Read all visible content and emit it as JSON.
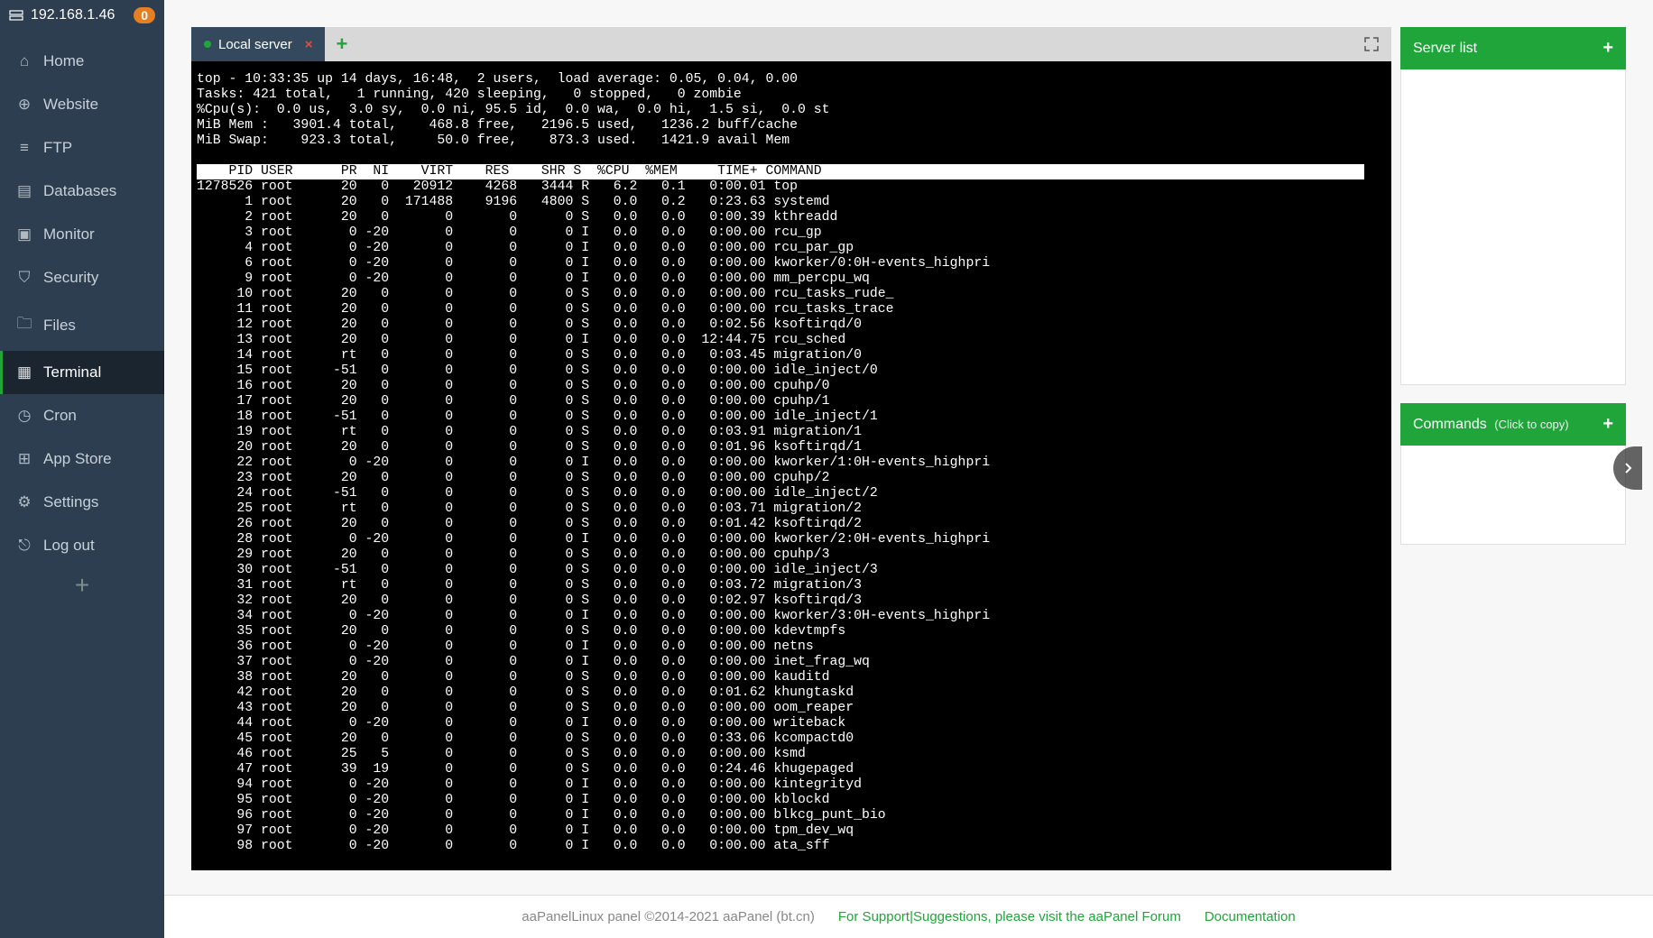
{
  "sidebar": {
    "ip": "192.168.1.46",
    "badge": "0",
    "items": [
      {
        "id": "home",
        "label": "Home"
      },
      {
        "id": "website",
        "label": "Website"
      },
      {
        "id": "ftp",
        "label": "FTP"
      },
      {
        "id": "databases",
        "label": "Databases"
      },
      {
        "id": "monitor",
        "label": "Monitor"
      },
      {
        "id": "security",
        "label": "Security"
      },
      {
        "id": "files",
        "label": "Files"
      },
      {
        "id": "terminal",
        "label": "Terminal"
      },
      {
        "id": "cron",
        "label": "Cron"
      },
      {
        "id": "appstore",
        "label": "App Store"
      },
      {
        "id": "settings",
        "label": "Settings"
      },
      {
        "id": "logout",
        "label": "Log out"
      }
    ],
    "active": "terminal"
  },
  "tabs": {
    "active_label": "Local server"
  },
  "right": {
    "server_list": "Server list",
    "commands_label": "Commands",
    "commands_hint": "(Click to copy)"
  },
  "footer": {
    "copyright": "aaPanelLinux panel ©2014-2021 aaPanel (bt.cn)",
    "forum": "For Support|Suggestions, please visit the aaPanel Forum",
    "docs": "Documentation"
  },
  "top": {
    "summary": [
      "top - 10:33:35 up 14 days, 16:48,  2 users,  load average: 0.05, 0.04, 0.00",
      "Tasks: 421 total,   1 running, 420 sleeping,   0 stopped,   0 zombie",
      "%Cpu(s):  0.0 us,  3.0 sy,  0.0 ni, 95.5 id,  0.0 wa,  0.0 hi,  1.5 si,  0.0 st",
      "MiB Mem :   3901.4 total,    468.8 free,   2196.5 used,   1236.2 buff/cache",
      "MiB Swap:    923.3 total,     50.0 free,    873.3 used.   1421.9 avail Mem"
    ],
    "header": "    PID USER      PR  NI    VIRT    RES    SHR S  %CPU  %MEM     TIME+ COMMAND",
    "rows": [
      {
        "pid": 1278526,
        "user": "root",
        "pr": "20",
        "ni": "0",
        "virt": "20912",
        "res": "4268",
        "shr": "3444",
        "s": "R",
        "cpu": "6.2",
        "mem": "0.1",
        "time": "0:00.01",
        "cmd": "top"
      },
      {
        "pid": 1,
        "user": "root",
        "pr": "20",
        "ni": "0",
        "virt": "171488",
        "res": "9196",
        "shr": "4800",
        "s": "S",
        "cpu": "0.0",
        "mem": "0.2",
        "time": "0:23.63",
        "cmd": "systemd"
      },
      {
        "pid": 2,
        "user": "root",
        "pr": "20",
        "ni": "0",
        "virt": "0",
        "res": "0",
        "shr": "0",
        "s": "S",
        "cpu": "0.0",
        "mem": "0.0",
        "time": "0:00.39",
        "cmd": "kthreadd"
      },
      {
        "pid": 3,
        "user": "root",
        "pr": "0",
        "ni": "-20",
        "virt": "0",
        "res": "0",
        "shr": "0",
        "s": "I",
        "cpu": "0.0",
        "mem": "0.0",
        "time": "0:00.00",
        "cmd": "rcu_gp"
      },
      {
        "pid": 4,
        "user": "root",
        "pr": "0",
        "ni": "-20",
        "virt": "0",
        "res": "0",
        "shr": "0",
        "s": "I",
        "cpu": "0.0",
        "mem": "0.0",
        "time": "0:00.00",
        "cmd": "rcu_par_gp"
      },
      {
        "pid": 6,
        "user": "root",
        "pr": "0",
        "ni": "-20",
        "virt": "0",
        "res": "0",
        "shr": "0",
        "s": "I",
        "cpu": "0.0",
        "mem": "0.0",
        "time": "0:00.00",
        "cmd": "kworker/0:0H-events_highpri"
      },
      {
        "pid": 9,
        "user": "root",
        "pr": "0",
        "ni": "-20",
        "virt": "0",
        "res": "0",
        "shr": "0",
        "s": "I",
        "cpu": "0.0",
        "mem": "0.0",
        "time": "0:00.00",
        "cmd": "mm_percpu_wq"
      },
      {
        "pid": 10,
        "user": "root",
        "pr": "20",
        "ni": "0",
        "virt": "0",
        "res": "0",
        "shr": "0",
        "s": "S",
        "cpu": "0.0",
        "mem": "0.0",
        "time": "0:00.00",
        "cmd": "rcu_tasks_rude_"
      },
      {
        "pid": 11,
        "user": "root",
        "pr": "20",
        "ni": "0",
        "virt": "0",
        "res": "0",
        "shr": "0",
        "s": "S",
        "cpu": "0.0",
        "mem": "0.0",
        "time": "0:00.00",
        "cmd": "rcu_tasks_trace"
      },
      {
        "pid": 12,
        "user": "root",
        "pr": "20",
        "ni": "0",
        "virt": "0",
        "res": "0",
        "shr": "0",
        "s": "S",
        "cpu": "0.0",
        "mem": "0.0",
        "time": "0:02.56",
        "cmd": "ksoftirqd/0"
      },
      {
        "pid": 13,
        "user": "root",
        "pr": "20",
        "ni": "0",
        "virt": "0",
        "res": "0",
        "shr": "0",
        "s": "I",
        "cpu": "0.0",
        "mem": "0.0",
        "time": "12:44.75",
        "cmd": "rcu_sched"
      },
      {
        "pid": 14,
        "user": "root",
        "pr": "rt",
        "ni": "0",
        "virt": "0",
        "res": "0",
        "shr": "0",
        "s": "S",
        "cpu": "0.0",
        "mem": "0.0",
        "time": "0:03.45",
        "cmd": "migration/0"
      },
      {
        "pid": 15,
        "user": "root",
        "pr": "-51",
        "ni": "0",
        "virt": "0",
        "res": "0",
        "shr": "0",
        "s": "S",
        "cpu": "0.0",
        "mem": "0.0",
        "time": "0:00.00",
        "cmd": "idle_inject/0"
      },
      {
        "pid": 16,
        "user": "root",
        "pr": "20",
        "ni": "0",
        "virt": "0",
        "res": "0",
        "shr": "0",
        "s": "S",
        "cpu": "0.0",
        "mem": "0.0",
        "time": "0:00.00",
        "cmd": "cpuhp/0"
      },
      {
        "pid": 17,
        "user": "root",
        "pr": "20",
        "ni": "0",
        "virt": "0",
        "res": "0",
        "shr": "0",
        "s": "S",
        "cpu": "0.0",
        "mem": "0.0",
        "time": "0:00.00",
        "cmd": "cpuhp/1"
      },
      {
        "pid": 18,
        "user": "root",
        "pr": "-51",
        "ni": "0",
        "virt": "0",
        "res": "0",
        "shr": "0",
        "s": "S",
        "cpu": "0.0",
        "mem": "0.0",
        "time": "0:00.00",
        "cmd": "idle_inject/1"
      },
      {
        "pid": 19,
        "user": "root",
        "pr": "rt",
        "ni": "0",
        "virt": "0",
        "res": "0",
        "shr": "0",
        "s": "S",
        "cpu": "0.0",
        "mem": "0.0",
        "time": "0:03.91",
        "cmd": "migration/1"
      },
      {
        "pid": 20,
        "user": "root",
        "pr": "20",
        "ni": "0",
        "virt": "0",
        "res": "0",
        "shr": "0",
        "s": "S",
        "cpu": "0.0",
        "mem": "0.0",
        "time": "0:01.96",
        "cmd": "ksoftirqd/1"
      },
      {
        "pid": 22,
        "user": "root",
        "pr": "0",
        "ni": "-20",
        "virt": "0",
        "res": "0",
        "shr": "0",
        "s": "I",
        "cpu": "0.0",
        "mem": "0.0",
        "time": "0:00.00",
        "cmd": "kworker/1:0H-events_highpri"
      },
      {
        "pid": 23,
        "user": "root",
        "pr": "20",
        "ni": "0",
        "virt": "0",
        "res": "0",
        "shr": "0",
        "s": "S",
        "cpu": "0.0",
        "mem": "0.0",
        "time": "0:00.00",
        "cmd": "cpuhp/2"
      },
      {
        "pid": 24,
        "user": "root",
        "pr": "-51",
        "ni": "0",
        "virt": "0",
        "res": "0",
        "shr": "0",
        "s": "S",
        "cpu": "0.0",
        "mem": "0.0",
        "time": "0:00.00",
        "cmd": "idle_inject/2"
      },
      {
        "pid": 25,
        "user": "root",
        "pr": "rt",
        "ni": "0",
        "virt": "0",
        "res": "0",
        "shr": "0",
        "s": "S",
        "cpu": "0.0",
        "mem": "0.0",
        "time": "0:03.71",
        "cmd": "migration/2"
      },
      {
        "pid": 26,
        "user": "root",
        "pr": "20",
        "ni": "0",
        "virt": "0",
        "res": "0",
        "shr": "0",
        "s": "S",
        "cpu": "0.0",
        "mem": "0.0",
        "time": "0:01.42",
        "cmd": "ksoftirqd/2"
      },
      {
        "pid": 28,
        "user": "root",
        "pr": "0",
        "ni": "-20",
        "virt": "0",
        "res": "0",
        "shr": "0",
        "s": "I",
        "cpu": "0.0",
        "mem": "0.0",
        "time": "0:00.00",
        "cmd": "kworker/2:0H-events_highpri"
      },
      {
        "pid": 29,
        "user": "root",
        "pr": "20",
        "ni": "0",
        "virt": "0",
        "res": "0",
        "shr": "0",
        "s": "S",
        "cpu": "0.0",
        "mem": "0.0",
        "time": "0:00.00",
        "cmd": "cpuhp/3"
      },
      {
        "pid": 30,
        "user": "root",
        "pr": "-51",
        "ni": "0",
        "virt": "0",
        "res": "0",
        "shr": "0",
        "s": "S",
        "cpu": "0.0",
        "mem": "0.0",
        "time": "0:00.00",
        "cmd": "idle_inject/3"
      },
      {
        "pid": 31,
        "user": "root",
        "pr": "rt",
        "ni": "0",
        "virt": "0",
        "res": "0",
        "shr": "0",
        "s": "S",
        "cpu": "0.0",
        "mem": "0.0",
        "time": "0:03.72",
        "cmd": "migration/3"
      },
      {
        "pid": 32,
        "user": "root",
        "pr": "20",
        "ni": "0",
        "virt": "0",
        "res": "0",
        "shr": "0",
        "s": "S",
        "cpu": "0.0",
        "mem": "0.0",
        "time": "0:02.97",
        "cmd": "ksoftirqd/3"
      },
      {
        "pid": 34,
        "user": "root",
        "pr": "0",
        "ni": "-20",
        "virt": "0",
        "res": "0",
        "shr": "0",
        "s": "I",
        "cpu": "0.0",
        "mem": "0.0",
        "time": "0:00.00",
        "cmd": "kworker/3:0H-events_highpri"
      },
      {
        "pid": 35,
        "user": "root",
        "pr": "20",
        "ni": "0",
        "virt": "0",
        "res": "0",
        "shr": "0",
        "s": "S",
        "cpu": "0.0",
        "mem": "0.0",
        "time": "0:00.00",
        "cmd": "kdevtmpfs"
      },
      {
        "pid": 36,
        "user": "root",
        "pr": "0",
        "ni": "-20",
        "virt": "0",
        "res": "0",
        "shr": "0",
        "s": "I",
        "cpu": "0.0",
        "mem": "0.0",
        "time": "0:00.00",
        "cmd": "netns"
      },
      {
        "pid": 37,
        "user": "root",
        "pr": "0",
        "ni": "-20",
        "virt": "0",
        "res": "0",
        "shr": "0",
        "s": "I",
        "cpu": "0.0",
        "mem": "0.0",
        "time": "0:00.00",
        "cmd": "inet_frag_wq"
      },
      {
        "pid": 38,
        "user": "root",
        "pr": "20",
        "ni": "0",
        "virt": "0",
        "res": "0",
        "shr": "0",
        "s": "S",
        "cpu": "0.0",
        "mem": "0.0",
        "time": "0:00.00",
        "cmd": "kauditd"
      },
      {
        "pid": 42,
        "user": "root",
        "pr": "20",
        "ni": "0",
        "virt": "0",
        "res": "0",
        "shr": "0",
        "s": "S",
        "cpu": "0.0",
        "mem": "0.0",
        "time": "0:01.62",
        "cmd": "khungtaskd"
      },
      {
        "pid": 43,
        "user": "root",
        "pr": "20",
        "ni": "0",
        "virt": "0",
        "res": "0",
        "shr": "0",
        "s": "S",
        "cpu": "0.0",
        "mem": "0.0",
        "time": "0:00.00",
        "cmd": "oom_reaper"
      },
      {
        "pid": 44,
        "user": "root",
        "pr": "0",
        "ni": "-20",
        "virt": "0",
        "res": "0",
        "shr": "0",
        "s": "I",
        "cpu": "0.0",
        "mem": "0.0",
        "time": "0:00.00",
        "cmd": "writeback"
      },
      {
        "pid": 45,
        "user": "root",
        "pr": "20",
        "ni": "0",
        "virt": "0",
        "res": "0",
        "shr": "0",
        "s": "S",
        "cpu": "0.0",
        "mem": "0.0",
        "time": "0:33.06",
        "cmd": "kcompactd0"
      },
      {
        "pid": 46,
        "user": "root",
        "pr": "25",
        "ni": "5",
        "virt": "0",
        "res": "0",
        "shr": "0",
        "s": "S",
        "cpu": "0.0",
        "mem": "0.0",
        "time": "0:00.00",
        "cmd": "ksmd"
      },
      {
        "pid": 47,
        "user": "root",
        "pr": "39",
        "ni": "19",
        "virt": "0",
        "res": "0",
        "shr": "0",
        "s": "S",
        "cpu": "0.0",
        "mem": "0.0",
        "time": "0:24.46",
        "cmd": "khugepaged"
      },
      {
        "pid": 94,
        "user": "root",
        "pr": "0",
        "ni": "-20",
        "virt": "0",
        "res": "0",
        "shr": "0",
        "s": "I",
        "cpu": "0.0",
        "mem": "0.0",
        "time": "0:00.00",
        "cmd": "kintegrityd"
      },
      {
        "pid": 95,
        "user": "root",
        "pr": "0",
        "ni": "-20",
        "virt": "0",
        "res": "0",
        "shr": "0",
        "s": "I",
        "cpu": "0.0",
        "mem": "0.0",
        "time": "0:00.00",
        "cmd": "kblockd"
      },
      {
        "pid": 96,
        "user": "root",
        "pr": "0",
        "ni": "-20",
        "virt": "0",
        "res": "0",
        "shr": "0",
        "s": "I",
        "cpu": "0.0",
        "mem": "0.0",
        "time": "0:00.00",
        "cmd": "blkcg_punt_bio"
      },
      {
        "pid": 97,
        "user": "root",
        "pr": "0",
        "ni": "-20",
        "virt": "0",
        "res": "0",
        "shr": "0",
        "s": "I",
        "cpu": "0.0",
        "mem": "0.0",
        "time": "0:00.00",
        "cmd": "tpm_dev_wq"
      },
      {
        "pid": 98,
        "user": "root",
        "pr": "0",
        "ni": "-20",
        "virt": "0",
        "res": "0",
        "shr": "0",
        "s": "I",
        "cpu": "0.0",
        "mem": "0.0",
        "time": "0:00.00",
        "cmd": "ata_sff"
      }
    ]
  },
  "icons": {
    "home": "⌂",
    "website": "⊕",
    "ftp": "≡",
    "databases": "▤",
    "monitor": "▣",
    "security": "⛉",
    "files": "🗀",
    "terminal": "▦",
    "cron": "◷",
    "appstore": "⊞",
    "settings": "⚙",
    "logout": "⎋"
  }
}
